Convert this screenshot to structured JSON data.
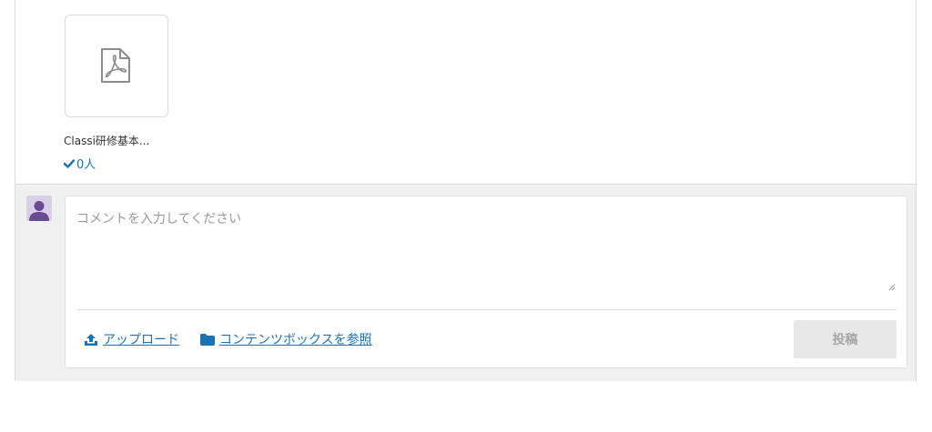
{
  "attachment": {
    "file_name": "Classi研修基本...",
    "file_icon": "pdf-file-icon",
    "read_check_icon": "check-icon",
    "read_count": "0人"
  },
  "comment": {
    "avatar_icon": "user-icon",
    "placeholder": "コメントを入力してください",
    "value": "",
    "upload_icon": "upload-icon",
    "upload_label": "アップロード",
    "browse_icon": "folder-icon",
    "browse_label": "コンテンツボックスを参照",
    "post_label": "投稿"
  },
  "colors": {
    "link": "#1a73b8",
    "avatar_bg": "#d9cfe6",
    "avatar_fg": "#6a4a93",
    "panel_bg": "#f0f0f0",
    "post_button_bg": "#e8e8e8",
    "post_button_text": "#a6a6a6"
  }
}
